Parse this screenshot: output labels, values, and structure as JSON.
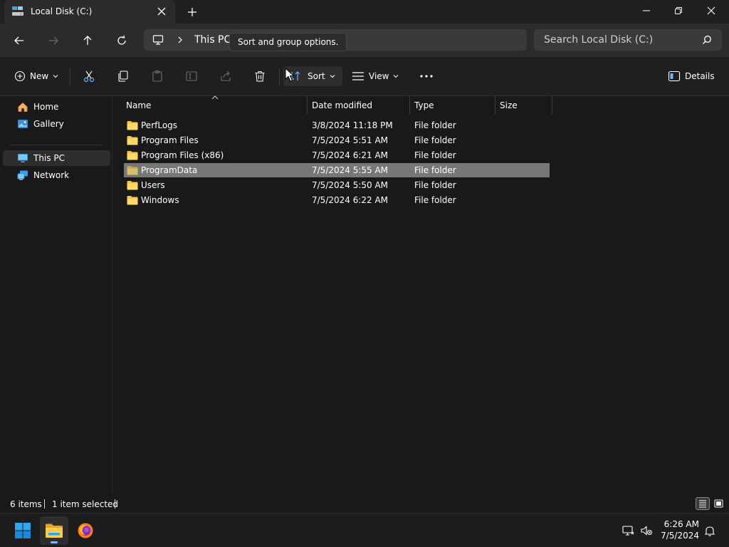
{
  "window": {
    "tab_title": "Local Disk (C:)",
    "tab_icon": "drive-icon",
    "controls": [
      "minimize-icon",
      "restore-icon",
      "close-icon"
    ]
  },
  "address": {
    "crumbs": [
      "This PC"
    ],
    "search_placeholder": "Search Local Disk (C:)"
  },
  "tooltip": {
    "text": "Sort and group options."
  },
  "commandbar": {
    "new_label": "New",
    "sort_label": "Sort",
    "view_label": "View",
    "details_label": "Details",
    "icons": [
      "cut-icon",
      "copy-icon",
      "paste-icon",
      "rename-icon",
      "share-icon",
      "delete-icon"
    ]
  },
  "nav": {
    "items": [
      {
        "label": "Home",
        "icon": "home-icon"
      },
      {
        "label": "Gallery",
        "icon": "gallery-icon"
      },
      {
        "label": "This PC",
        "icon": "monitor-icon"
      },
      {
        "label": "Network",
        "icon": "network-icon"
      }
    ],
    "selected": "This PC"
  },
  "files": {
    "columns": [
      "Name",
      "Date modified",
      "Type",
      "Size"
    ],
    "rows": [
      {
        "name": "PerfLogs",
        "date": "3/8/2024 11:18 PM",
        "type": "File folder",
        "size": ""
      },
      {
        "name": "Program Files",
        "date": "7/5/2024 5:51 AM",
        "type": "File folder",
        "size": ""
      },
      {
        "name": "Program Files (x86)",
        "date": "7/5/2024 6:21 AM",
        "type": "File folder",
        "size": ""
      },
      {
        "name": "ProgramData",
        "date": "7/5/2024 5:55 AM",
        "type": "File folder",
        "size": ""
      },
      {
        "name": "Users",
        "date": "7/5/2024 5:50 AM",
        "type": "File folder",
        "size": ""
      },
      {
        "name": "Windows",
        "date": "7/5/2024 6:22 AM",
        "type": "File folder",
        "size": ""
      }
    ],
    "selected_row": "ProgramData"
  },
  "status": {
    "item_count": "6 items",
    "selection": "1 item selected"
  },
  "taskbar": {
    "time": "6:26 AM",
    "date": "7/5/2024",
    "apps": [
      "windows-start-icon",
      "file-explorer-icon",
      "firefox-icon"
    ]
  },
  "colors": {
    "accent": "#4cc2ff",
    "folder": "#f4c243",
    "selection": "#777777"
  }
}
